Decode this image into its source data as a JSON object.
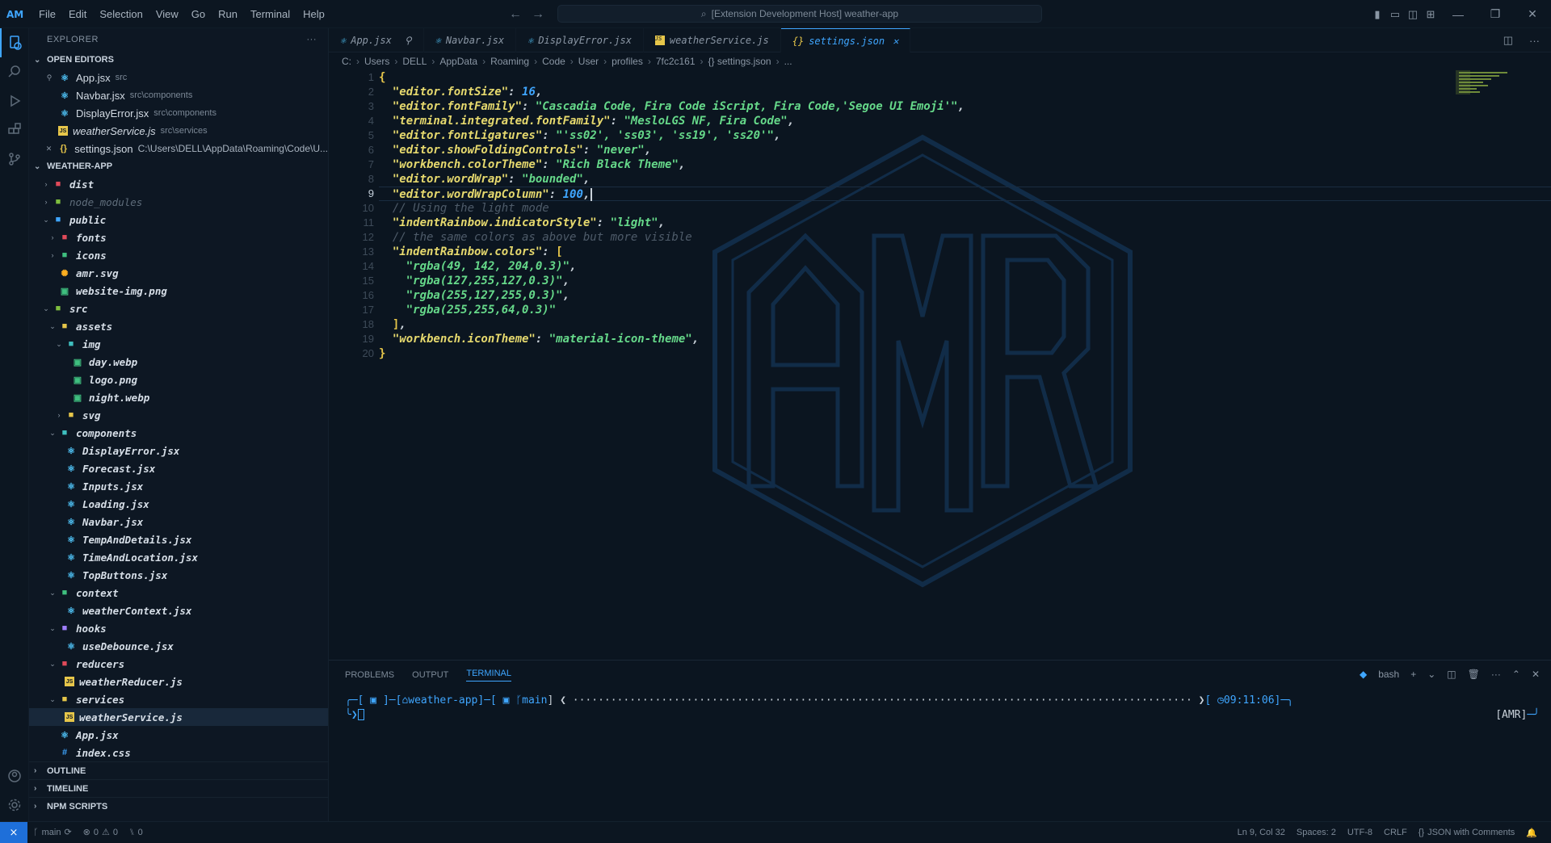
{
  "titlebar": {
    "menu": [
      "File",
      "Edit",
      "Selection",
      "View",
      "Go",
      "Run",
      "Terminal",
      "Help"
    ],
    "command_center": "[Extension Development Host] weather-app"
  },
  "sidebar": {
    "title": "EXPLORER",
    "open_editors_label": "OPEN EDITORS",
    "open_editors": [
      {
        "name": "App.jsx",
        "desc": "src",
        "icon": "react-icon"
      },
      {
        "name": "Navbar.jsx",
        "desc": "src\\components",
        "icon": "react-icon"
      },
      {
        "name": "DisplayError.jsx",
        "desc": "src\\components",
        "icon": "react-icon"
      },
      {
        "name": "weatherService.js",
        "desc": "src\\services",
        "icon": "js-icon"
      },
      {
        "name": "settings.json",
        "desc": "C:\\Users\\DELL\\AppData\\Roaming\\Code\\U...",
        "icon": "json-icon"
      }
    ],
    "workspace_label": "WEATHER-APP",
    "tree": [
      {
        "name": "dist",
        "depth": 0,
        "type": "folder",
        "open": false,
        "color": "#e04a5a"
      },
      {
        "name": "node_modules",
        "depth": 0,
        "type": "folder",
        "open": false,
        "color": "#7fbf3f",
        "dim": true
      },
      {
        "name": "public",
        "depth": 0,
        "type": "folder",
        "open": true,
        "color": "#3fa6ff"
      },
      {
        "name": "fonts",
        "depth": 1,
        "type": "folder",
        "open": false,
        "color": "#e04a5a"
      },
      {
        "name": "icons",
        "depth": 1,
        "type": "folder",
        "open": false,
        "color": "#3fbf7f"
      },
      {
        "name": "amr.svg",
        "depth": 1,
        "type": "file",
        "color": "#ffb020"
      },
      {
        "name": "website-img.png",
        "depth": 1,
        "type": "file",
        "color": "#3fbf7f"
      },
      {
        "name": "src",
        "depth": 0,
        "type": "folder",
        "open": true,
        "color": "#7fbf3f"
      },
      {
        "name": "assets",
        "depth": 1,
        "type": "folder",
        "open": true,
        "color": "#e6c64a"
      },
      {
        "name": "img",
        "depth": 2,
        "type": "folder",
        "open": true,
        "color": "#3fbfbf"
      },
      {
        "name": "day.webp",
        "depth": 3,
        "type": "file",
        "color": "#3fbf7f"
      },
      {
        "name": "logo.png",
        "depth": 3,
        "type": "file",
        "color": "#3fbf7f"
      },
      {
        "name": "night.webp",
        "depth": 3,
        "type": "file",
        "color": "#3fbf7f"
      },
      {
        "name": "svg",
        "depth": 2,
        "type": "folder",
        "open": false,
        "color": "#e6c64a"
      },
      {
        "name": "components",
        "depth": 1,
        "type": "folder",
        "open": true,
        "color": "#3fbfbf"
      },
      {
        "name": "DisplayError.jsx",
        "depth": 2,
        "type": "react",
        "color": "#4fc3f7"
      },
      {
        "name": "Forecast.jsx",
        "depth": 2,
        "type": "react",
        "color": "#4fc3f7"
      },
      {
        "name": "Inputs.jsx",
        "depth": 2,
        "type": "react",
        "color": "#4fc3f7"
      },
      {
        "name": "Loading.jsx",
        "depth": 2,
        "type": "react",
        "color": "#4fc3f7"
      },
      {
        "name": "Navbar.jsx",
        "depth": 2,
        "type": "react",
        "color": "#4fc3f7"
      },
      {
        "name": "TempAndDetails.jsx",
        "depth": 2,
        "type": "react",
        "color": "#4fc3f7"
      },
      {
        "name": "TimeAndLocation.jsx",
        "depth": 2,
        "type": "react",
        "color": "#4fc3f7"
      },
      {
        "name": "TopButtons.jsx",
        "depth": 2,
        "type": "react",
        "color": "#4fc3f7"
      },
      {
        "name": "context",
        "depth": 1,
        "type": "folder",
        "open": true,
        "color": "#3fbf7f"
      },
      {
        "name": "weatherContext.jsx",
        "depth": 2,
        "type": "react",
        "color": "#4fc3f7"
      },
      {
        "name": "hooks",
        "depth": 1,
        "type": "folder",
        "open": true,
        "color": "#9f7fff"
      },
      {
        "name": "useDebounce.jsx",
        "depth": 2,
        "type": "react",
        "color": "#4fc3f7"
      },
      {
        "name": "reducers",
        "depth": 1,
        "type": "folder",
        "open": true,
        "color": "#e04a5a"
      },
      {
        "name": "weatherReducer.js",
        "depth": 2,
        "type": "js",
        "color": "#e6c64a"
      },
      {
        "name": "services",
        "depth": 1,
        "type": "folder",
        "open": true,
        "color": "#e6c64a"
      },
      {
        "name": "weatherService.js",
        "depth": 2,
        "type": "js",
        "color": "#e6c64a",
        "selected": true
      },
      {
        "name": "App.jsx",
        "depth": 1,
        "type": "react",
        "color": "#4fc3f7"
      },
      {
        "name": "index.css",
        "depth": 1,
        "type": "css",
        "color": "#3fa6ff"
      }
    ],
    "bottom_sections": [
      "OUTLINE",
      "TIMELINE",
      "NPM SCRIPTS"
    ]
  },
  "tabs": [
    {
      "name": "App.jsx",
      "icon": "react-icon",
      "active": false
    },
    {
      "name": "Navbar.jsx",
      "icon": "react-icon",
      "active": false
    },
    {
      "name": "DisplayError.jsx",
      "icon": "react-icon",
      "active": false
    },
    {
      "name": "weatherService.js",
      "icon": "js-icon",
      "active": false
    },
    {
      "name": "settings.json",
      "icon": "json-icon",
      "active": true
    }
  ],
  "breadcrumb": [
    "C:",
    "Users",
    "DELL",
    "AppData",
    "Roaming",
    "Code",
    "User",
    "profiles",
    "7fc2c161",
    "{} settings.json",
    "..."
  ],
  "editor": {
    "current_line": 9,
    "lines": [
      [
        [
          "b",
          "{"
        ]
      ],
      [
        [
          "p",
          "  "
        ],
        [
          "k",
          "\"editor.fontSize\""
        ],
        [
          "p",
          ": "
        ],
        [
          "n",
          "16"
        ],
        [
          "p",
          ","
        ]
      ],
      [
        [
          "p",
          "  "
        ],
        [
          "k",
          "\"editor.fontFamily\""
        ],
        [
          "p",
          ": "
        ],
        [
          "s",
          "\"Cascadia Code, Fira Code iScript, Fira Code,'Segoe UI Emoji'\""
        ],
        [
          "p",
          ","
        ]
      ],
      [
        [
          "p",
          "  "
        ],
        [
          "k",
          "\"terminal.integrated.fontFamily\""
        ],
        [
          "p",
          ": "
        ],
        [
          "s",
          "\"MesloLGS NF, Fira Code\""
        ],
        [
          "p",
          ","
        ]
      ],
      [
        [
          "p",
          "  "
        ],
        [
          "k",
          "\"editor.fontLigatures\""
        ],
        [
          "p",
          ": "
        ],
        [
          "s",
          "\"'ss02', 'ss03', 'ss19', 'ss20'\""
        ],
        [
          "p",
          ","
        ]
      ],
      [
        [
          "p",
          "  "
        ],
        [
          "k",
          "\"editor.showFoldingControls\""
        ],
        [
          "p",
          ": "
        ],
        [
          "s",
          "\"never\""
        ],
        [
          "p",
          ","
        ]
      ],
      [
        [
          "p",
          "  "
        ],
        [
          "k",
          "\"workbench.colorTheme\""
        ],
        [
          "p",
          ": "
        ],
        [
          "s",
          "\"Rich Black Theme\""
        ],
        [
          "p",
          ","
        ]
      ],
      [
        [
          "p",
          "  "
        ],
        [
          "k",
          "\"editor.wordWrap\""
        ],
        [
          "p",
          ": "
        ],
        [
          "s",
          "\"bounded\""
        ],
        [
          "p",
          ","
        ]
      ],
      [
        [
          "p",
          "  "
        ],
        [
          "k",
          "\"editor.wordWrapColumn\""
        ],
        [
          "p",
          ": "
        ],
        [
          "n",
          "100"
        ],
        [
          "p",
          ","
        ]
      ],
      [
        [
          "p",
          "  "
        ],
        [
          "c",
          "// Using the light mode"
        ]
      ],
      [
        [
          "p",
          "  "
        ],
        [
          "k",
          "\"indentRainbow.indicatorStyle\""
        ],
        [
          "p",
          ": "
        ],
        [
          "s",
          "\"light\""
        ],
        [
          "p",
          ","
        ]
      ],
      [
        [
          "p",
          "  "
        ],
        [
          "c",
          "// the same colors as above but more visible"
        ]
      ],
      [
        [
          "p",
          "  "
        ],
        [
          "k",
          "\"indentRainbow.colors\""
        ],
        [
          "p",
          ": "
        ],
        [
          "b",
          "["
        ]
      ],
      [
        [
          "p",
          "    "
        ],
        [
          "s",
          "\"rgba(49, 142, 204,0.3)\""
        ],
        [
          "p",
          ","
        ]
      ],
      [
        [
          "p",
          "    "
        ],
        [
          "s",
          "\"rgba(127,255,127,0.3)\""
        ],
        [
          "p",
          ","
        ]
      ],
      [
        [
          "p",
          "    "
        ],
        [
          "s",
          "\"rgba(255,127,255,0.3)\""
        ],
        [
          "p",
          ","
        ]
      ],
      [
        [
          "p",
          "    "
        ],
        [
          "s",
          "\"rgba(255,255,64,0.3)\""
        ]
      ],
      [
        [
          "p",
          "  "
        ],
        [
          "b",
          "]"
        ],
        [
          "p",
          ","
        ]
      ],
      [
        [
          "p",
          "  "
        ],
        [
          "k",
          "\"workbench.iconTheme\""
        ],
        [
          "p",
          ": "
        ],
        [
          "s",
          "\"material-icon-theme\""
        ],
        [
          "p",
          ","
        ]
      ],
      [
        [
          "b",
          "}"
        ]
      ]
    ]
  },
  "panel": {
    "tabs": [
      "PROBLEMS",
      "OUTPUT",
      "TERMINAL"
    ],
    "active_tab": "TERMINAL",
    "shell": "bash",
    "prompt_dir": "weather-app",
    "prompt_branch": "main",
    "prompt_time": "09:11:06",
    "prompt_user": "[AMR]"
  },
  "statusbar": {
    "branch": "main",
    "errors": "0",
    "warnings": "0",
    "ports": "0",
    "position": "Ln 9, Col 32",
    "spaces": "Spaces: 2",
    "encoding": "UTF-8",
    "eol": "CRLF",
    "language": "JSON with Comments"
  },
  "colors": {
    "accent": "#3fa6ff",
    "key": "#e6d96e",
    "string": "#66d98a",
    "number": "#3fa6ff",
    "comment": "#4e5b69"
  }
}
